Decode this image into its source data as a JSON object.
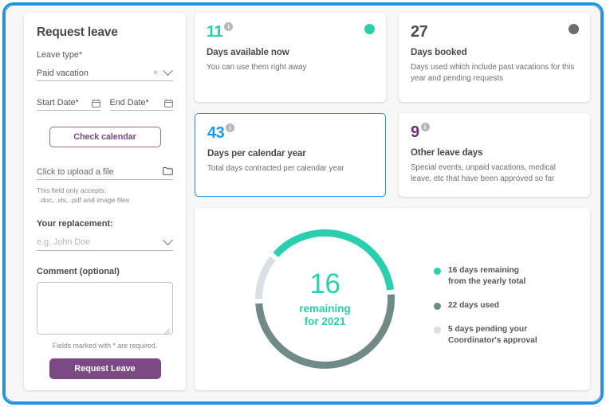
{
  "theme": {
    "frame_blue": "#1396e8",
    "frame_violet": "#4e5fd0",
    "teal": "#2ad0ae",
    "slate": "#6f8a87",
    "light_gray": "#d9dfe2",
    "purple": "#7b4a85",
    "blue": "#1f9ae0",
    "page_bg": "#f7f7f8"
  },
  "form": {
    "title": "Request leave",
    "leave_type_label": "Leave type*",
    "leave_type_value": "Paid vacation",
    "clear_icon": "×",
    "start_date_label": "Start Date*",
    "end_date_label": "End Date*",
    "check_calendar_button": "Check calendar",
    "upload_label": "Click to upload a file",
    "hint_line1": "This field only accepts:",
    "hint_line2": ".doc, .xls, .pdf and image files",
    "replacement_label": "Your replacement:",
    "replacement_placeholder": "e.g. John Doe",
    "comment_label": "Comment (optional)",
    "comment_value": "",
    "required_note": "Fields marked with * are required.",
    "submit_button": "Request Leave"
  },
  "stats": [
    {
      "value": "11",
      "title": "Days available now",
      "desc": "You can use them right away",
      "value_color": "#2ad0ae",
      "has_info": true,
      "dot_color": "#2ad0ae",
      "highlighted": false
    },
    {
      "value": "27",
      "title": "Days booked",
      "desc": "Days used which include past vacations for this year and pending requests",
      "value_color": "#4a4a52",
      "has_info": false,
      "dot_color": "#6b6b73",
      "highlighted": false
    },
    {
      "value": "43",
      "title": "Days per calendar year",
      "desc": "Total days contracted per calendar year",
      "value_color": "#1f9ae0",
      "has_info": true,
      "dot_color": "",
      "highlighted": true
    },
    {
      "value": "9",
      "title": "Other leave days",
      "desc": "Special events, unpaid vacations, medical leave, etc that have been approved so far",
      "value_color": "#6a2f77",
      "has_info": true,
      "dot_color": "",
      "highlighted": false
    }
  ],
  "chart_data": {
    "type": "pie",
    "title": "",
    "center_value": "16",
    "center_line1": "remaining",
    "center_line2": "for 2021",
    "total": 43,
    "categories": [
      "16 days remaining from the yearly total",
      "22 days used",
      "5 days pending your Coordinator's approval"
    ],
    "values": [
      16,
      22,
      5
    ],
    "colors": [
      "#2ad0ae",
      "#6f8a87",
      "#d9dfe2"
    ],
    "legend_position": "right",
    "legend": [
      {
        "label_line1": "16 days remaining",
        "label_line2": "from the yearly total",
        "color": "#2ad0ae",
        "value": 16
      },
      {
        "label_line1": "22 days used",
        "label_line2": "",
        "color": "#6f8a87",
        "value": 22
      },
      {
        "label_line1": "5 days pending your",
        "label_line2": "Coordinator's approval",
        "color": "#d9dfe2",
        "value": 5
      }
    ]
  }
}
